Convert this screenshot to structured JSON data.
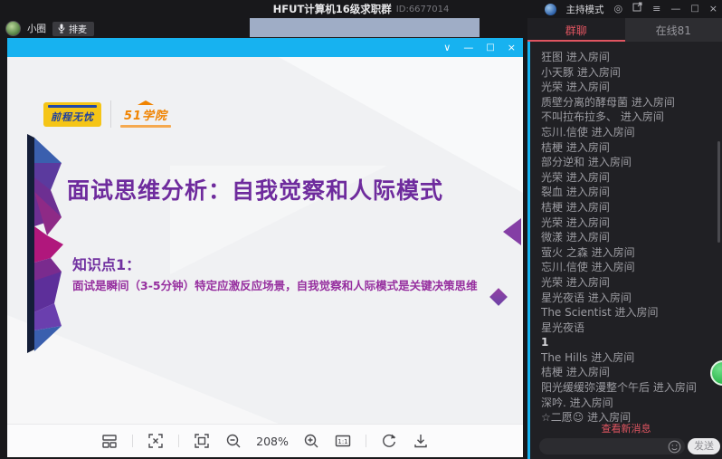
{
  "app": {
    "title": "HFUT计算机16级求职群",
    "room_id": "ID:6677014",
    "mode_label": "主持模式",
    "window_icons": [
      "settings-icon",
      "popout-icon",
      "menu-icon",
      "minimize-icon",
      "maximize-icon",
      "close-icon"
    ]
  },
  "host_bar": {
    "user_name": "小圈",
    "mic_queue_button": "排麦"
  },
  "presentation": {
    "titlebar_icons": [
      "collapse-icon",
      "minimize-icon",
      "maximize-icon",
      "close-icon"
    ],
    "slide": {
      "logo_primary": "前程无忧",
      "logo_secondary": "51学院",
      "title": "面试思维分析：自我觉察和人际模式",
      "knowledge_point_label": "知识点1：",
      "knowledge_point_text": "面试是瞬间（3-5分钟）特定应激反应场景，自我觉察和人际模式是关键决策思维"
    },
    "toolbar": {
      "zoom_level": "208%",
      "icons": [
        "slides-panel-icon",
        "expand-icon",
        "fit-screen-icon",
        "zoom-out-icon",
        "zoom-in-icon",
        "actual-size-icon",
        "rotate-icon",
        "download-icon"
      ]
    }
  },
  "sidebar": {
    "tabs": [
      {
        "label": "群聊",
        "active": true
      },
      {
        "label": "在线81",
        "active": false
      }
    ],
    "messages": [
      {
        "user": "狂图",
        "action": "进入房间"
      },
      {
        "user": "小天豚",
        "action": "进入房间"
      },
      {
        "user": "光荣",
        "action": "进入房间"
      },
      {
        "user": "质壁分离的酵母菌",
        "action": "进入房间"
      },
      {
        "user": "不叫拉布拉多、",
        "action": "进入房间"
      },
      {
        "user": "忘川.信使",
        "action": "进入房间"
      },
      {
        "user": "桔梗",
        "action": "进入房间"
      },
      {
        "user": "部分逆和",
        "action": "进入房间"
      },
      {
        "user": "光荣",
        "action": "进入房间"
      },
      {
        "user": "裂血",
        "action": "进入房间"
      },
      {
        "user": "桔梗",
        "action": "进入房间"
      },
      {
        "user": "光荣",
        "action": "进入房间"
      },
      {
        "user": "微漾",
        "action": "进入房间"
      },
      {
        "user": "萤火    之森",
        "action": "进入房间"
      },
      {
        "user": "忘川.信使",
        "action": "进入房间"
      },
      {
        "user": "光荣",
        "action": "进入房间"
      },
      {
        "user": "星光夜语",
        "action": "进入房间"
      },
      {
        "user": "The Scientist",
        "action": "进入房间"
      },
      {
        "user": "星光夜语",
        "action": "",
        "message": "1"
      },
      {
        "user": "The Hills",
        "action": "进入房间"
      },
      {
        "user": "桔梗",
        "action": "进入房间"
      },
      {
        "user": "阳光缓缓弥漫整个午后",
        "action": "进入房间"
      },
      {
        "user": "深吟.",
        "action": "进入房间"
      },
      {
        "user": "☆二愿☺",
        "action": "进入房间"
      }
    ],
    "view_new_messages": "查看新消息",
    "send_button": "发送",
    "input_value": ""
  },
  "colors": {
    "accent_cyan": "#17b2f0",
    "tab_red": "#e05561",
    "slide_title_purple": "#6e2b9d",
    "slide_text_purple": "#962f9f",
    "logo_yellow": "#f5c517",
    "logo_blue": "#1d3fa0",
    "logo_orange": "#f08300",
    "float_green": "#2fb84f",
    "video_strip_gray": "#9fadc6"
  }
}
